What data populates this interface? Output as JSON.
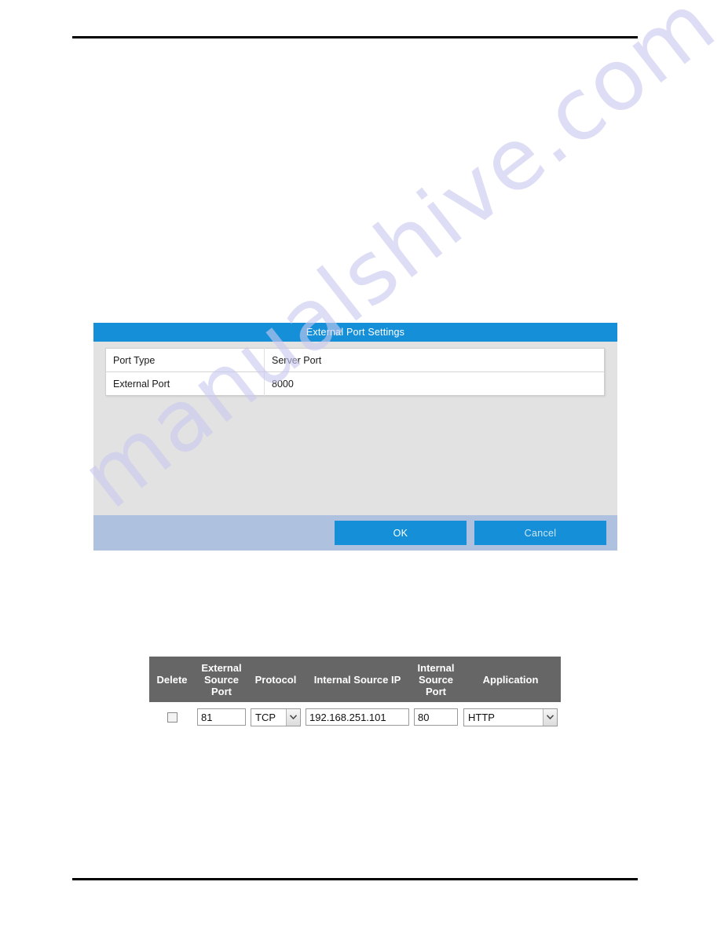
{
  "page": {
    "header_rule": "",
    "footer_rule": "",
    "watermark": "manualshive.com"
  },
  "dialog": {
    "title": "External Port Settings",
    "rows": [
      {
        "label": "Port Type",
        "value": "Server Port"
      },
      {
        "label": "External Port",
        "value": "8000"
      }
    ],
    "ok_label": "OK",
    "cancel_label": "Cancel",
    "title_bg": "#1590d8",
    "footer_bg": "#aec1de",
    "body_bg": "#e2e2e2"
  },
  "forward_table": {
    "header_bg": "#666666",
    "columns": [
      "Delete",
      "External Source Port",
      "Protocol",
      "Internal Source IP",
      "Internal Source Port",
      "Application"
    ],
    "rows": [
      {
        "delete_checked": false,
        "external_source_port": "81",
        "protocol": "TCP",
        "internal_source_ip": "192.168.251.101",
        "internal_source_port": "80",
        "application": "HTTP"
      }
    ]
  }
}
